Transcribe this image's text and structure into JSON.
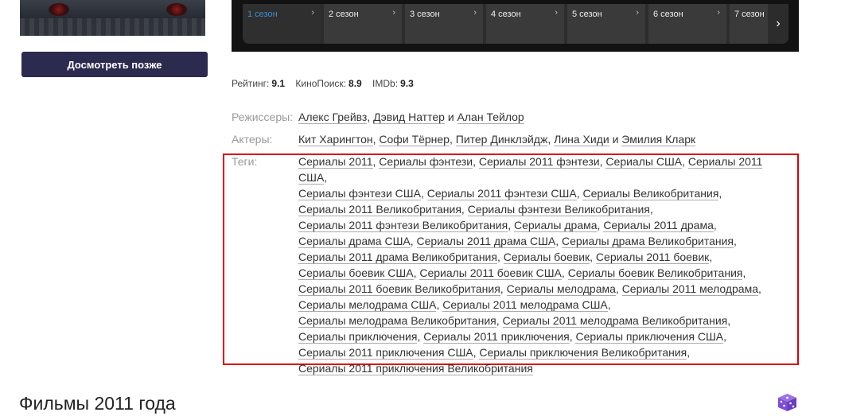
{
  "sidebar": {
    "watch_later_label": "Досмотреть позже"
  },
  "seasons": [
    {
      "label": "1 сезон",
      "active": true
    },
    {
      "label": "2 сезон",
      "active": false
    },
    {
      "label": "3 сезон",
      "active": false
    },
    {
      "label": "4 сезон",
      "active": false
    },
    {
      "label": "5 сезон",
      "active": false
    },
    {
      "label": "6 сезон",
      "active": false
    },
    {
      "label": "7 сезон",
      "active": false
    }
  ],
  "ratings": {
    "site_label": "Рейтинг:",
    "site_value": "9.1",
    "kp_label": "КиноПоиск:",
    "kp_value": "8.9",
    "imdb_label": "IMDb:",
    "imdb_value": "9.3"
  },
  "directors": {
    "label": "Режиссеры:",
    "names": [
      "Алекс Грейвз",
      "Дэвид Наттер",
      "Алан Тейлор"
    ],
    "conjunction": "и"
  },
  "actors": {
    "label": "Актеры:",
    "names": [
      "Кит Харингтон",
      "Софи Тёрнер",
      "Питер Динклэйдж",
      "Лина Хиди",
      "Эмилия Кларк"
    ],
    "conjunction": "и"
  },
  "tags": {
    "label": "Теги:",
    "lines": [
      [
        "Сериалы 2011",
        "Сериалы фэнтези",
        "Сериалы 2011 фэнтези",
        "Сериалы США",
        "Сериалы 2011 США"
      ],
      [
        "Сериалы фэнтези США",
        "Сериалы 2011 фэнтези США",
        "Сериалы Великобритания"
      ],
      [
        "Сериалы 2011 Великобритания",
        "Сериалы фэнтези Великобритания"
      ],
      [
        "Сериалы 2011 фэнтези Великобритания",
        "Сериалы драма",
        "Сериалы 2011 драма"
      ],
      [
        "Сериалы драма США",
        "Сериалы 2011 драма США",
        "Сериалы драма Великобритания"
      ],
      [
        "Сериалы 2011 драма Великобритания",
        "Сериалы боевик",
        "Сериалы 2011 боевик"
      ],
      [
        "Сериалы боевик США",
        "Сериалы 2011 боевик США",
        "Сериалы боевик Великобритания"
      ],
      [
        "Сериалы 2011 боевик Великобритания",
        "Сериалы мелодрама",
        "Сериалы 2011 мелодрама"
      ],
      [
        "Сериалы мелодрама США",
        "Сериалы 2011 мелодрама США"
      ],
      [
        "Сериалы мелодрама Великобритания",
        "Сериалы 2011 мелодрама Великобритания"
      ],
      [
        "Сериалы приключения",
        "Сериалы 2011 приключения",
        "Сериалы приключения США"
      ],
      [
        "Сериалы 2011 приключения США",
        "Сериалы приключения Великобритания"
      ],
      [
        "Сериалы 2011 приключения Великобритания"
      ]
    ]
  },
  "section": {
    "heading": "Фильмы 2011 года"
  },
  "icons": {
    "season_chevron": "chevron-right-icon",
    "seasons_next": "chevron-right-icon",
    "random": "dice-icon"
  },
  "colors": {
    "button_bg": "#2d2a4f",
    "active_season": "#3a8fd0",
    "highlight_border": "#e0000b",
    "dice": "#7e4fd6"
  }
}
